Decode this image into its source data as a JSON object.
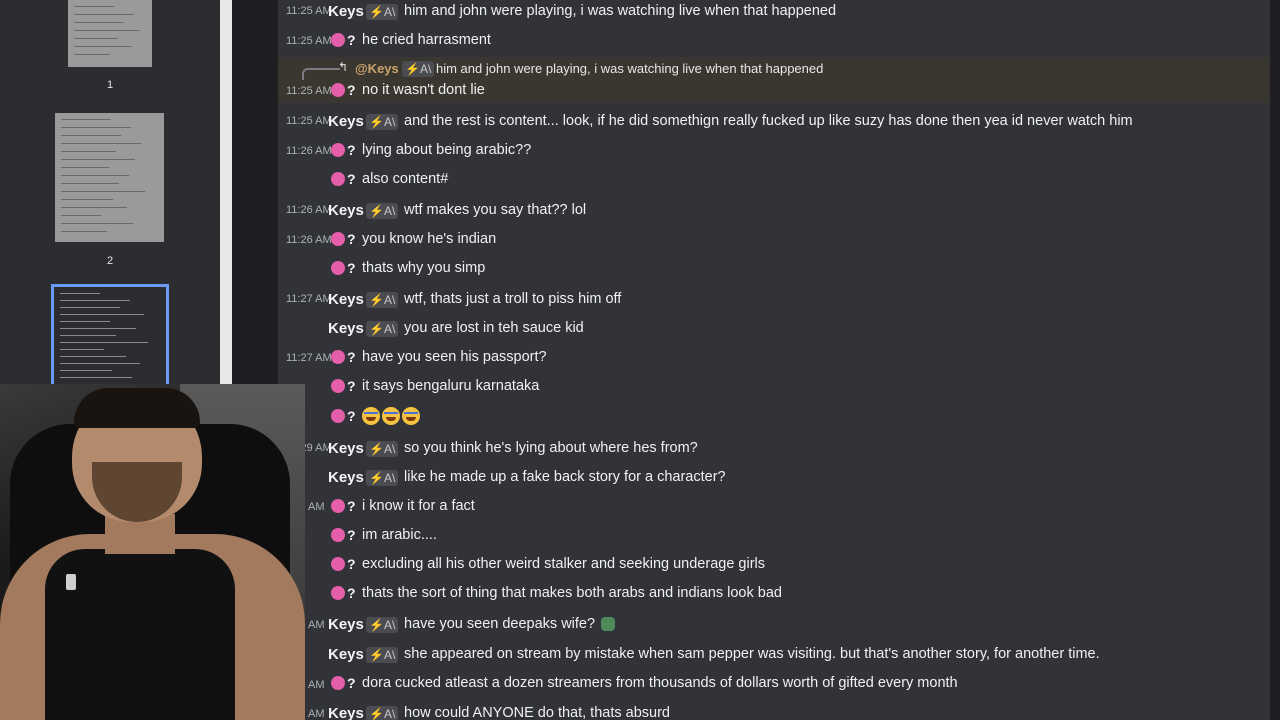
{
  "sidebar": {
    "pages": [
      {
        "number": "1",
        "selected": false
      },
      {
        "number": "2",
        "selected": false
      },
      {
        "number": "",
        "selected": true
      }
    ]
  },
  "chat": {
    "reply": {
      "user": "@Keys",
      "badge": "⚡A\\",
      "text": "him and john were playing, i was watching live when that happened"
    },
    "messages": [
      {
        "time": "11:25 AM",
        "user": "Keys",
        "badge": "⚡A\\",
        "text": "him and john were playing, i was watching live when that happened"
      },
      {
        "time": "11:25 AM",
        "user": "?",
        "text": "he cried harrasment"
      },
      {
        "time": "11:25 AM",
        "user": "?",
        "text": "no it wasn't dont lie"
      },
      {
        "time": "11:25 AM",
        "user": "Keys",
        "badge": "⚡A\\",
        "text": "and the rest is content... look, if he did somethign really fucked up like suzy has done then yea id never watch him"
      },
      {
        "time": "11:26 AM",
        "user": "?",
        "text": "lying about being arabic??"
      },
      {
        "time": "",
        "user": "?",
        "text": "also content#"
      },
      {
        "time": "11:26 AM",
        "user": "Keys",
        "badge": "⚡A\\",
        "text": "wtf makes you say that?? lol"
      },
      {
        "time": "11:26 AM",
        "user": "?",
        "text": "you know he's indian"
      },
      {
        "time": "",
        "user": "?",
        "text": "thats why you simp"
      },
      {
        "time": "11:27 AM",
        "user": "Keys",
        "badge": "⚡A\\",
        "text": "wtf, thats just a troll to piss him off"
      },
      {
        "time": "",
        "user": "Keys",
        "badge": "⚡A\\",
        "text": "you are lost in teh sauce kid"
      },
      {
        "time": "11:27 AM",
        "user": "?",
        "text": "have you seen his passport?"
      },
      {
        "time": "",
        "user": "?",
        "text": "it says bengaluru karnataka"
      },
      {
        "time": "",
        "user": "?",
        "text": ""
      },
      {
        "time": "11:29 AM",
        "user": "Keys",
        "badge": "⚡A\\",
        "text": "so you think he's lying about where hes from?"
      },
      {
        "time": "",
        "user": "Keys",
        "badge": "⚡A\\",
        "text": "like he made up a fake back story for a character?"
      },
      {
        "time": "AM",
        "user": "?",
        "text": "i know it for a fact"
      },
      {
        "time": "",
        "user": "?",
        "text": "im arabic...."
      },
      {
        "time": "",
        "user": "?",
        "text": "excluding all his other weird stalker and seeking underage girls"
      },
      {
        "time": "",
        "user": "?",
        "text": "thats the sort of thing that makes both arabs and indians look bad"
      },
      {
        "time": "AM",
        "user": "Keys",
        "badge": "⚡A\\",
        "text": "have you seen deepaks wife?"
      },
      {
        "time": "",
        "user": "Keys",
        "badge": "⚡A\\",
        "text": "she appeared on stream by mistake when sam pepper was visiting.  but that's another story, for another time."
      },
      {
        "time": "AM",
        "user": "?",
        "text": "dora cucked atleast a dozen streamers from thousands of dollars worth of gifted every month"
      },
      {
        "time": "AM",
        "user": "Keys",
        "badge": "⚡A\\",
        "text": "how could ANYONE do that, thats absurd"
      }
    ]
  },
  "colors": {
    "avatar_pink": "#e45ea9",
    "chat_bg": "#313338",
    "highlight": "#3a3730",
    "selected_border": "#6b9cf5"
  },
  "icons": {
    "reply": "reply-arrow-icon",
    "emoji": "laughing-crying-emoji-icon",
    "sticker": "green-face-sticker-icon"
  }
}
